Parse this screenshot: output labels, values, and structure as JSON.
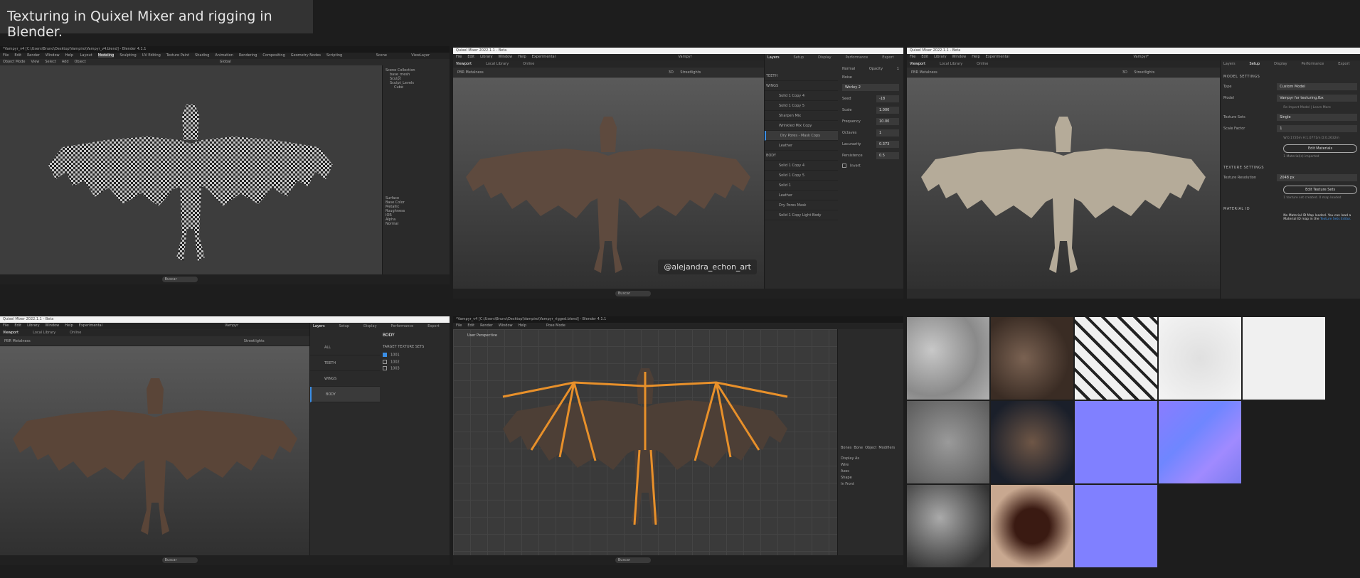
{
  "caption": "Texturing in Quixel Mixer and rigging in Blender.",
  "blender_top": {
    "title": "*Vampyr_v4 [C:\\Users\\Bruno\\Desktop\\Vampiro\\Vampyr_v4.blend] - Blender 4.1.1",
    "menus": [
      "File",
      "Edit",
      "Render",
      "Window",
      "Help"
    ],
    "workspaces": [
      "Layout",
      "Modeling",
      "Sculpting",
      "UV Editing",
      "Texture Paint",
      "Shading",
      "Animation",
      "Rendering",
      "Compositing",
      "Geometry Nodes",
      "Scripting"
    ],
    "mode": "Object Mode",
    "toolbar": [
      "View",
      "Select",
      "Add",
      "Object"
    ],
    "orientation": "Global",
    "scene": "Scene",
    "view_layer": "ViewLayer",
    "outliner": [
      "Scene Collection",
      "base_mesh",
      "Sculpt",
      "Sculpt_Levels",
      "Cube"
    ],
    "props": [
      "Surface",
      "Base Color",
      "Metallic",
      "Roughness",
      "IOR",
      "Alpha",
      "Normal"
    ],
    "taskbar_search": "Buscar"
  },
  "mixer_top": {
    "title": "Quixel Mixer 2022.1.1 - Beta",
    "menus": [
      "File",
      "Edit",
      "Library",
      "Window",
      "Help",
      "Experimental"
    ],
    "project": "Vampyr",
    "tabs": [
      "Viewport",
      "Local Library",
      "Online"
    ],
    "panel_tabs": [
      "Layers",
      "Setup",
      "Display",
      "Performance",
      "Export"
    ],
    "render_mode": "PBR Metalness",
    "view": "3D",
    "lighting": "Streetlights",
    "layers": [
      "TEETH",
      "WINGS",
      "Solid 1 Copy 4",
      "Solid 1 Copy 5",
      "Sharpen Mix",
      "Wrinkled Mix Copy",
      "Dry Pores - Mask Copy",
      "Leather",
      "BODY",
      "Solid 1 Copy 4",
      "Solid 1 Copy 5",
      "Solid 1",
      "Leather",
      "Dry Pores Mask",
      "Solid 1 Copy Light Body"
    ],
    "props": {
      "blend": "Normal",
      "opacity_label": "Opacity",
      "opacity": "1",
      "noise": "Noise",
      "noise_type": "Worley 2",
      "fields": [
        [
          "Seed",
          "-18"
        ],
        [
          "Scale",
          "1.000"
        ],
        [
          "Frequency",
          "10.00"
        ],
        [
          "Octaves",
          "1"
        ],
        [
          "Lacunarity",
          "0.373"
        ],
        [
          "Persistence",
          "0.5"
        ]
      ],
      "invert": "Invert"
    },
    "watermark": "@alejandra_echon_art",
    "taskbar_search": "Buscar"
  },
  "mixer_setup": {
    "title": "Quixel Mixer 2022.1.1 - Beta",
    "project": "Vampyr*",
    "model_settings": "MODEL SETTINGS",
    "type_label": "Type",
    "type": "Custom Model",
    "model_label": "Model",
    "model": "Vampyr for texturing.fbx",
    "reimport": "Re-Import Model | Learn More",
    "texture_sets_label": "Texture Sets",
    "texture_sets": "Single",
    "scale_label": "Scale Factor",
    "scale": "1",
    "dims": "W:0.1726m H:1.0771m D:0.2632m",
    "edit_materials": "Edit Materials",
    "materials_info": "1 Material(s) imported",
    "texture_settings": "TEXTURE SETTINGS",
    "res_label": "Texture Resolution",
    "res": "2048 px",
    "edit_texture_sets": "Edit Texture Sets",
    "texture_info": "1 texture set created. 0 map loaded",
    "material_id": "MATERIAL ID",
    "material_id_text": "No Material ID Map loaded. You can load a Material ID map in the",
    "material_id_link": "Texture Sets Editor."
  },
  "mixer_bottom": {
    "title": "Quixel Mixer 2022.1.1 - Beta",
    "project": "Vampyr",
    "layers": [
      "ALL",
      "TEETH",
      "WINGS",
      "BODY"
    ],
    "selected": "BODY",
    "target_label": "TARGET TEXTURE SETS",
    "sets": [
      {
        "name": "1001",
        "checked": true
      },
      {
        "name": "1002",
        "checked": false
      },
      {
        "name": "1003",
        "checked": false
      }
    ],
    "taskbar_search": "Buscar"
  },
  "blender_bottom": {
    "title": "*Vampyr_v4 [C:\\Users\\Bruno\\Desktop\\Vampiro\\Vampyr_rigged.blend] - Blender 4.1.1",
    "mode": "Pose Mode",
    "viewport_info": "User Perspective",
    "properties_tabs": [
      "Bones",
      "Bone",
      "Object",
      "Modifiers"
    ],
    "prop_fields": [
      "Display As",
      "Wire",
      "Axes",
      "Shape",
      "In Front"
    ],
    "taskbar_search": "Buscar"
  },
  "colors": {
    "accent": "#3a8ee6",
    "bone": "#e8902a",
    "normal_map": "#8080ff"
  }
}
